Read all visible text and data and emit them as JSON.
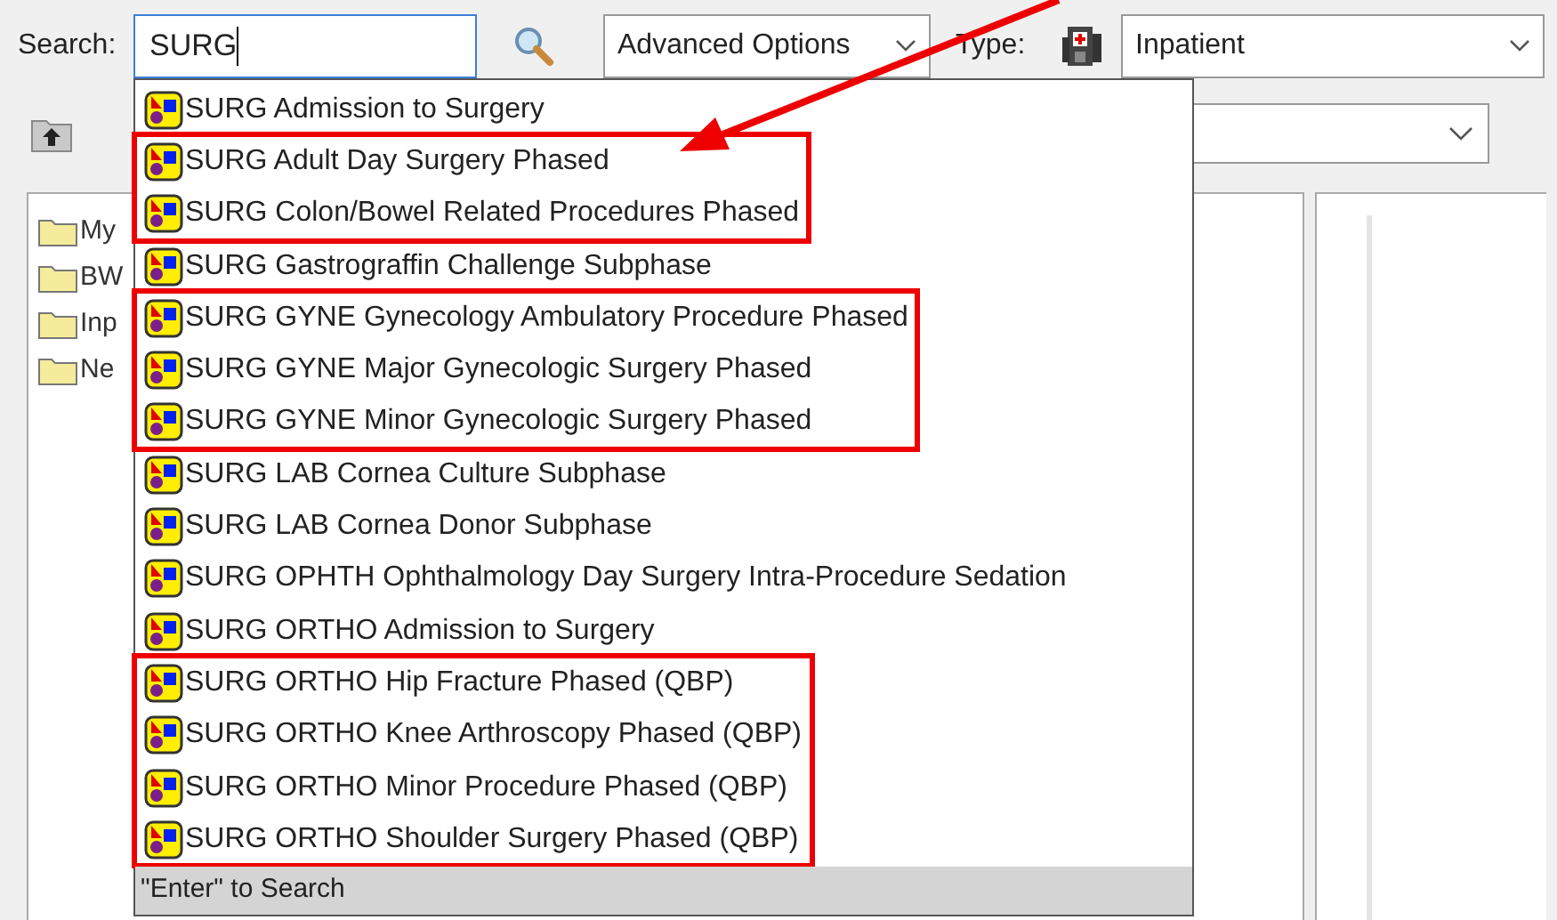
{
  "search": {
    "label": "Search:",
    "value": "SURG"
  },
  "advanced_options": {
    "value": "Advanced Options"
  },
  "type": {
    "label": "Type:",
    "value": "Inpatient"
  },
  "folders": [
    {
      "label": "My"
    },
    {
      "label": "BW"
    },
    {
      "label": "Inp"
    },
    {
      "label": "Ne"
    }
  ],
  "results": [
    {
      "label": "SURG Admission to Surgery",
      "highlighted": false
    },
    {
      "label": "SURG Adult Day Surgery Phased",
      "highlighted": true
    },
    {
      "label": "SURG Colon/Bowel Related Procedures Phased",
      "highlighted": true
    },
    {
      "label": "SURG Gastrograffin Challenge Subphase",
      "highlighted": false
    },
    {
      "label": "SURG GYNE Gynecology Ambulatory Procedure Phased",
      "highlighted": true
    },
    {
      "label": "SURG GYNE Major Gynecologic Surgery Phased",
      "highlighted": true
    },
    {
      "label": "SURG GYNE Minor Gynecologic Surgery Phased",
      "highlighted": true
    },
    {
      "label": "SURG LAB Cornea Culture Subphase",
      "highlighted": false
    },
    {
      "label": "SURG LAB Cornea Donor Subphase",
      "highlighted": false
    },
    {
      "label": "SURG OPHTH Ophthalmology Day Surgery Intra-Procedure Sedation",
      "highlighted": false
    },
    {
      "label": "SURG ORTHO Admission to Surgery",
      "highlighted": false
    },
    {
      "label": "SURG ORTHO Hip Fracture Phased (QBP)",
      "highlighted": true
    },
    {
      "label": "SURG ORTHO Knee Arthroscopy Phased (QBP)",
      "highlighted": true
    },
    {
      "label": "SURG ORTHO Minor Procedure Phased (QBP)",
      "highlighted": true
    },
    {
      "label": "SURG ORTHO Shoulder Surgery Phased (QBP)",
      "highlighted": true
    }
  ],
  "results_footer": "\"Enter\" to Search",
  "pointer_arrow": true
}
